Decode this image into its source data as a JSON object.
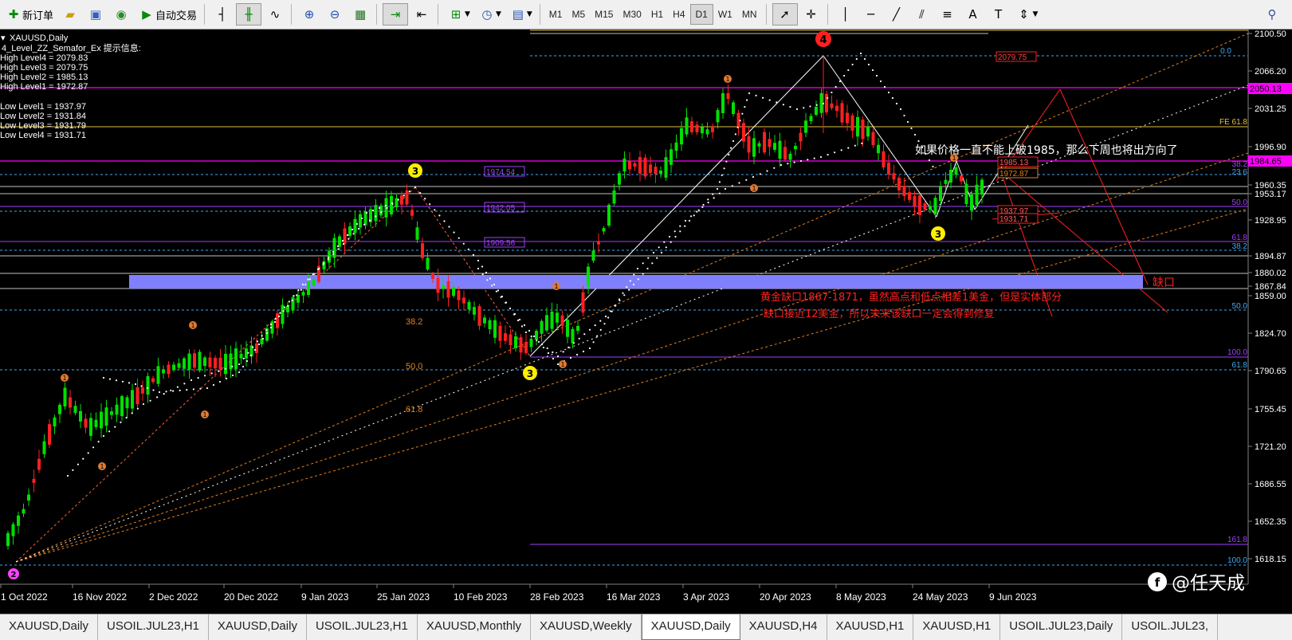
{
  "toolbar": {
    "new_order_label": "新订单",
    "auto_trade_label": "自动交易",
    "timeframes": [
      "M1",
      "M5",
      "M15",
      "M30",
      "H1",
      "H4",
      "D1",
      "W1",
      "MN"
    ],
    "active_timeframe": "D1"
  },
  "chart": {
    "symbol_title": "XAUUSD,Daily",
    "indicator_header": "4_Level_ZZ_Semafor_Ex 提示信息:",
    "high_levels": [
      "High Level4 = 2079.83",
      "High Level3 = 2079.75",
      "High Level2 = 1985.13",
      "High Level1 = 1972.87"
    ],
    "low_levels": [
      "Low Level1 = 1937.97",
      "Low Level2 = 1931.84",
      "Low Level3 = 1931.79",
      "Low Level4 = 1931.71"
    ],
    "price_axis": [
      "2100.50",
      "2066.20",
      "2031.25",
      "1996.90",
      "1960.35",
      "1953.17",
      "1928.95",
      "1894.87",
      "1880.02",
      "1867.84",
      "1859.00",
      "1824.70",
      "1790.65",
      "1755.45",
      "1721.20",
      "1686.55",
      "1652.35",
      "1618.15"
    ],
    "date_axis": [
      "1 Oct 2022",
      "16 Nov 2022",
      "2 Dec 2022",
      "20 Dec 2022",
      "9 Jan 2023",
      "25 Jan 2023",
      "10 Feb 2023",
      "28 Feb 2023",
      "16 Mar 2023",
      "3 Apr 2023",
      "20 Apr 2023",
      "8 May 2023",
      "24 May 2023",
      "9 Jun 2023"
    ],
    "boxed_prices": [
      "2079.75",
      "2050.13",
      "1984.65",
      "1985.13",
      "1972.87",
      "1937.97",
      "1931.71"
    ],
    "fib_labels": {
      "right": [
        "0.0",
        "FE 61.8",
        "38.2",
        "23.6",
        "50.0",
        "61.8",
        "38.2",
        "50.0",
        "100.0",
        "61.8",
        "161.8",
        "100.0"
      ],
      "left": [
        "38.2",
        "50.0",
        "61.8"
      ],
      "boxes": [
        "1974.54",
        "1942.05",
        "1909.56"
      ]
    },
    "semafor_labels": [
      "4",
      "3",
      "3",
      "3",
      "2"
    ],
    "annotation_top": "如果价格一直不能上破1985，那么下周也将出方向了",
    "annotation_gap_line1": "黄金缺口1867-1871，虽然高点和低点相差1美金，但是实体部分",
    "annotation_gap_line2": "缺口接近12美金，所以未来该缺口一定会得到修复",
    "gap_label": "缺口",
    "watermark": "@任天成",
    "colors": {
      "bull": "#00e000",
      "bear": "#ff2020",
      "gap_zone": "#8080ff",
      "annotation_red": "#ff2020",
      "magenta": "#ff00ff",
      "fib_orange": "#e08020"
    }
  },
  "tabs": [
    "XAUUSD,Daily",
    "USOIL.JUL23,H1",
    "XAUUSD,Daily",
    "USOIL.JUL23,H1",
    "XAUUSD,Monthly",
    "XAUUSD,Weekly",
    "XAUUSD,Daily",
    "XAUUSD,H4",
    "XAUUSD,H1",
    "XAUUSD,H1",
    "USOIL.JUL23,Daily",
    "USOIL.JUL23,"
  ],
  "active_tab_index": 6
}
